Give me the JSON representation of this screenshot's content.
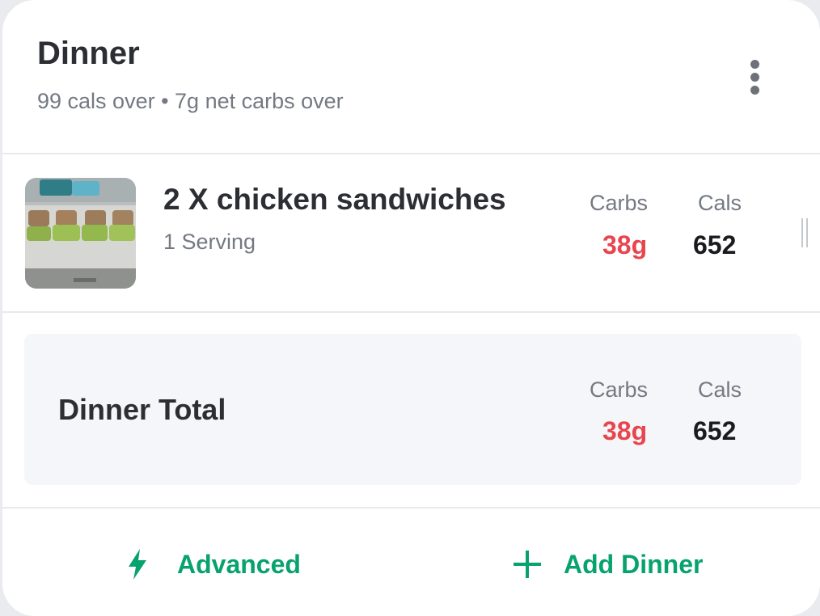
{
  "meal": {
    "title": "Dinner",
    "subtitle": "99 cals over • 7g net carbs over"
  },
  "item": {
    "name": "2 X chicken sandwiches",
    "serving": "1 Serving",
    "carbs_label": "Carbs",
    "cals_label": "Cals",
    "carbs": "38g",
    "cals": "652"
  },
  "total": {
    "label": "Dinner Total",
    "carbs_label": "Carbs",
    "cals_label": "Cals",
    "carbs": "38g",
    "cals": "652"
  },
  "footer": {
    "advanced_label": "Advanced",
    "add_label": "Add Dinner",
    "advanced_icon": "lightning-icon",
    "add_icon": "plus-icon"
  },
  "colors": {
    "accent": "#08a26f",
    "over_limit": "#e8454e",
    "text_primary": "#2c2e33",
    "text_secondary": "#747982"
  }
}
